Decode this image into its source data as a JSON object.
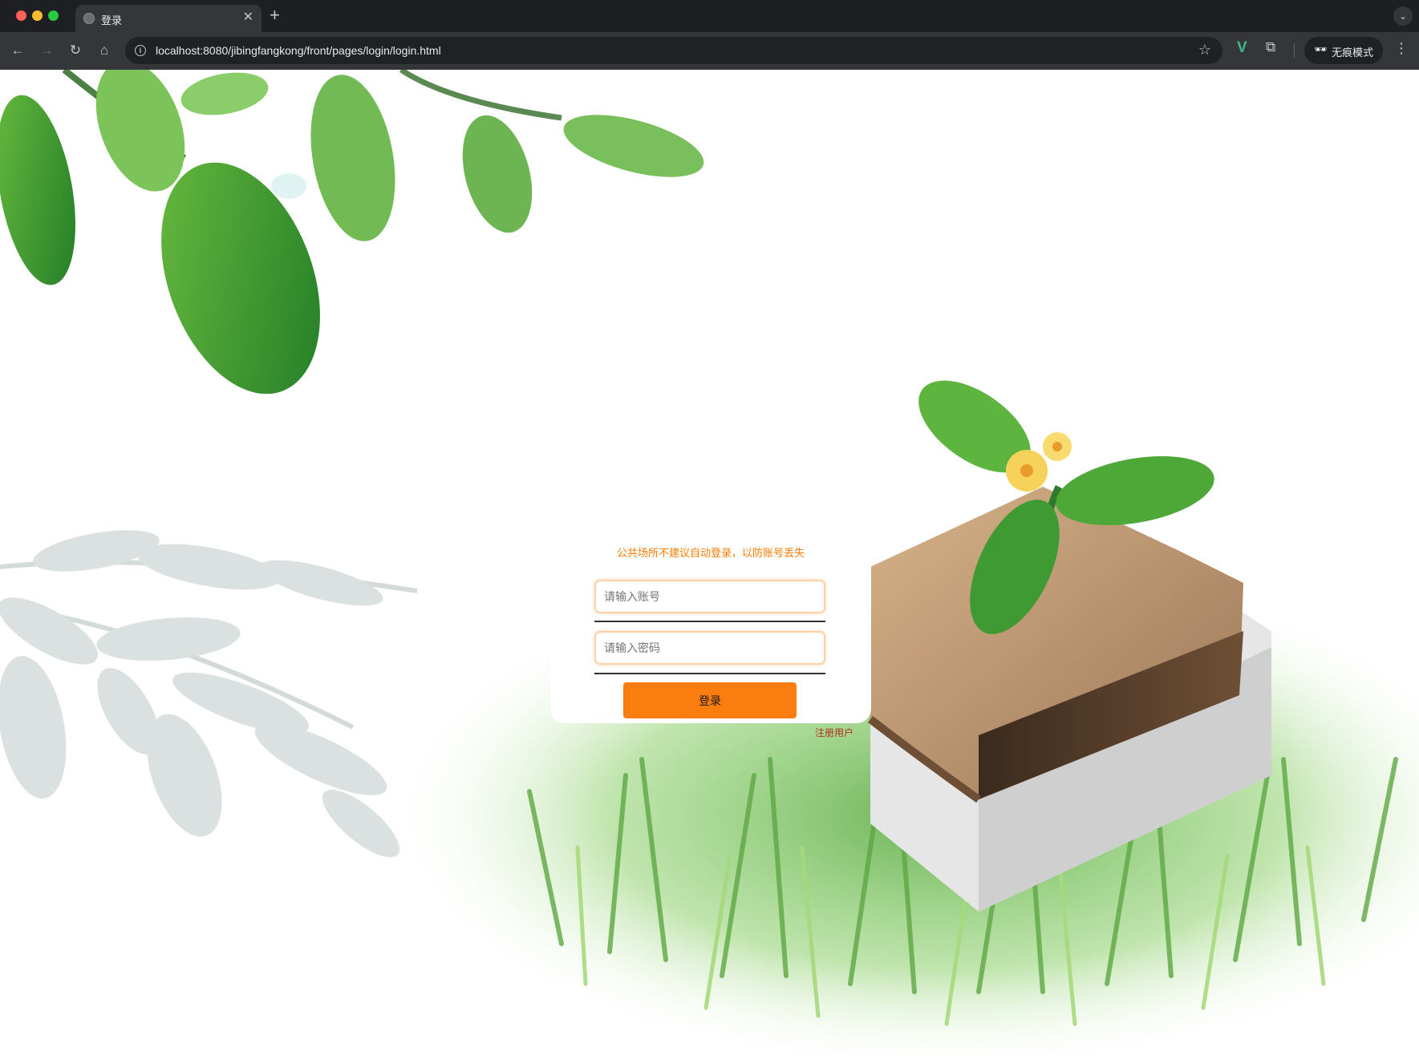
{
  "browser": {
    "tab_title": "登录",
    "url": "localhost:8080/jibingfangkong/front/pages/login/login.html",
    "profile_label": "无痕模式"
  },
  "login": {
    "notice": "公共场所不建议自动登录，以防账号丢失",
    "username_placeholder": "请输入账号",
    "password_placeholder": "请输入密码",
    "login_button": "登录",
    "register_link": "注册用户"
  },
  "colors": {
    "accent": "#fb7d0f",
    "notice": "#ff7a00",
    "register": "#b5311f"
  }
}
